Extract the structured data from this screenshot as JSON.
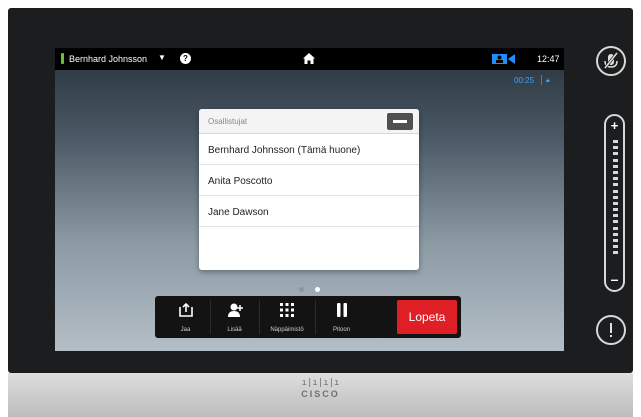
{
  "status_bar": {
    "caller_name": "Bernhard Johnsson",
    "clock": "12:47",
    "call_timer": "00:25"
  },
  "participants_panel": {
    "title": "Osallistujat",
    "participants": [
      "Bernhard Johnsson (Tämä huone)",
      "Anita Poscotto",
      "Jane Dawson"
    ]
  },
  "pager": {
    "pages": 2,
    "active": 2
  },
  "toolbar": {
    "share_label": "Jaa",
    "add_label": "Lisää",
    "keypad_label": "Näppäimistö",
    "hold_label": "Pitoon",
    "end_label": "Lopeta"
  },
  "volume": {
    "plus": "+",
    "minus": "–"
  },
  "hardware": {
    "logo_bars": "ı|ı|ı|ı",
    "logo_word": "CISCO"
  },
  "colors": {
    "end_call": "#e01e26",
    "mic_active": "#62c23a",
    "timer": "#3ba3ff",
    "camera_icon": "#1f8fff"
  },
  "icons": [
    "help-icon",
    "home-icon",
    "camera-icon",
    "lock-icon",
    "mute-icon",
    "share-icon",
    "add-participant-icon",
    "keypad-icon",
    "pause-icon",
    "info-icon",
    "layout-icon"
  ]
}
